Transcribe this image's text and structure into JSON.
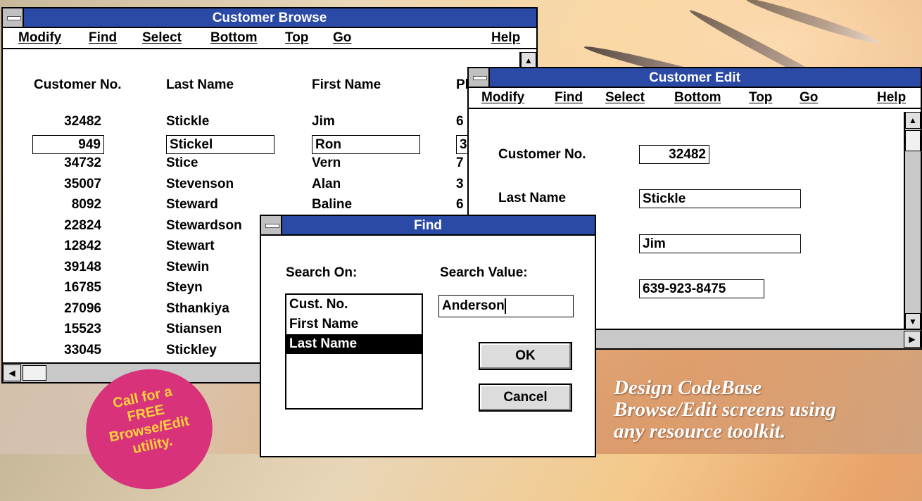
{
  "browse": {
    "title": "Customer Browse",
    "menu": [
      "Modify",
      "Find",
      "Select",
      "Bottom",
      "Top",
      "Go",
      "Help"
    ],
    "headers": [
      "Customer No.",
      "Last Name",
      "First Name",
      "Pl"
    ],
    "rows": [
      [
        "32482",
        "Stickle",
        "Jim",
        "6"
      ],
      [
        "949",
        "Stickel",
        "Ron",
        "3"
      ],
      [
        "34732",
        "Stice",
        "Vern",
        "7"
      ],
      [
        "35007",
        "Stevenson",
        "Alan",
        "3"
      ],
      [
        "8092",
        "Steward",
        "Baline",
        "6"
      ],
      [
        "22824",
        "Stewardson",
        "",
        ""
      ],
      [
        "12842",
        "Stewart",
        "",
        ""
      ],
      [
        "39148",
        "Stewin",
        "",
        ""
      ],
      [
        "16785",
        "Steyn",
        "",
        ""
      ],
      [
        "27096",
        "Sthankiya",
        "",
        ""
      ],
      [
        "15523",
        "Stiansen",
        "",
        ""
      ],
      [
        "33045",
        "Stickley",
        "",
        ""
      ]
    ]
  },
  "edit": {
    "title": "Customer Edit",
    "menu": [
      "Modify",
      "Find",
      "Select",
      "Bottom",
      "Top",
      "Go",
      "Help"
    ],
    "fields": [
      {
        "label": "Customer No.",
        "value": "32482"
      },
      {
        "label": "Last Name",
        "value": "Stickle"
      },
      {
        "label": "",
        "value": "Jim"
      },
      {
        "label": "",
        "value": "639-923-8475"
      }
    ]
  },
  "find": {
    "title": "Find",
    "search_on_label": "Search On:",
    "search_value_label": "Search Value:",
    "options": [
      "Cust. No.",
      "First Name",
      "Last Name"
    ],
    "selected_option": "Last Name",
    "search_value": "Anderson",
    "ok_label": "OK",
    "cancel_label": "Cancel"
  },
  "promo": {
    "lines": [
      "Call for a",
      "FREE",
      "Browse/Edit",
      "utility."
    ]
  },
  "tagline": {
    "lines": [
      "Design CodeBase",
      "Browse/Edit screens using",
      "any resource toolkit."
    ]
  },
  "colors": {
    "titlebar": "#2a4aa6",
    "selection": "#000000",
    "promo_bg": "#d8327a",
    "promo_text": "#ffd23a"
  }
}
